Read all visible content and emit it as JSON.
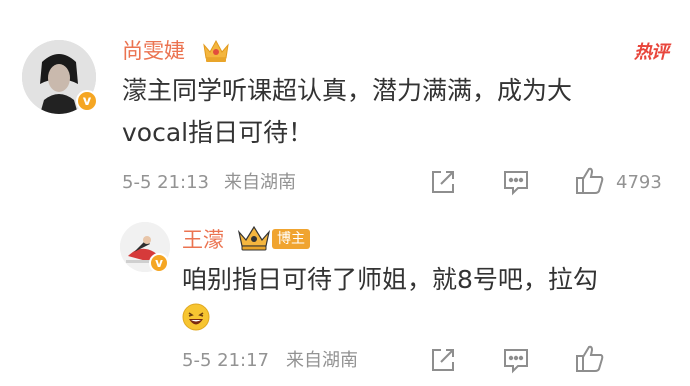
{
  "comment": {
    "username": "尚雯婕",
    "hot_label": "热评",
    "text_line1": "濛主同学听课超认真，潜力满满，成为大",
    "text_line2": "vocal指日可待！",
    "time": "5-5 21:13",
    "location": "来自湖南",
    "likes": "4793"
  },
  "reply": {
    "username": "王濛",
    "badge": "博主",
    "text": "咱别指日可待了师姐，就8号吧，拉勾",
    "time": "5-5 21:17",
    "location": "来自湖南"
  },
  "icons": {
    "crown": "crown-icon",
    "verified": "verified-v-icon",
    "share": "share-icon",
    "comment": "comment-icon",
    "like": "like-icon",
    "emoji": "laughing-emoji-icon"
  },
  "colors": {
    "username": "#eb7350",
    "hot": "#e8463c",
    "verified": "#f5a623",
    "meta": "#939393",
    "text": "#333333"
  }
}
